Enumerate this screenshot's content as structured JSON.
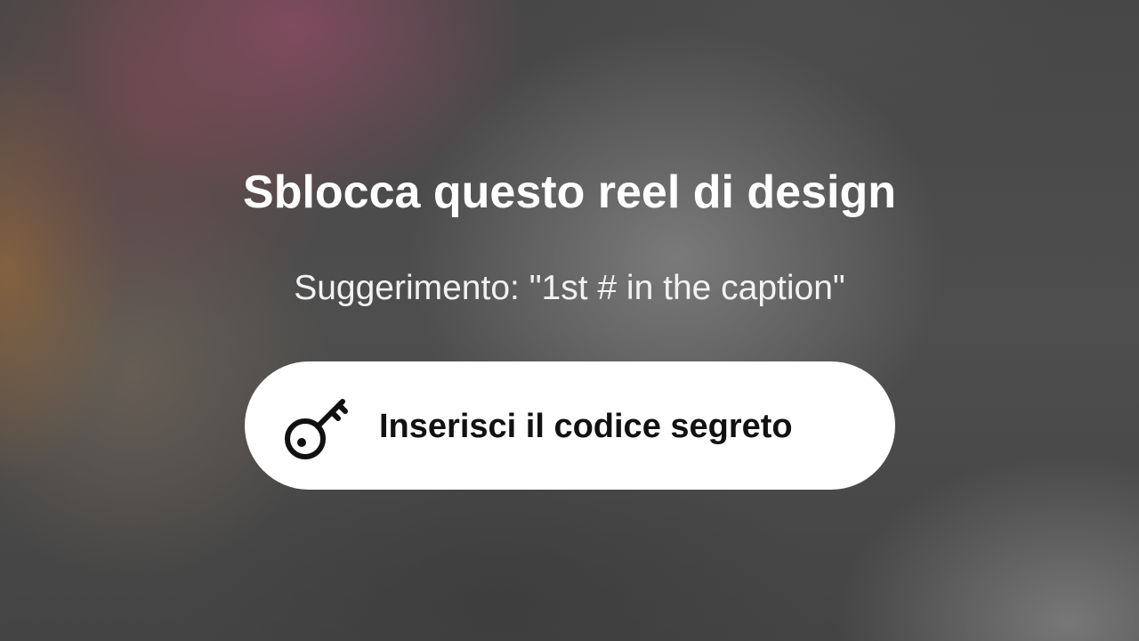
{
  "lock_screen": {
    "title": "Sblocca questo reel di design",
    "hint": "Suggerimento: \"1st # in the caption\""
  },
  "unlock_button": {
    "label": "Inserisci il codice segreto",
    "icon": "key-icon",
    "background": "#ffffff",
    "text_color": "#111111"
  },
  "colors": {
    "title_text": "#ffffff",
    "hint_text": "#f2f2f2",
    "backdrop": "#4c4c4c"
  }
}
